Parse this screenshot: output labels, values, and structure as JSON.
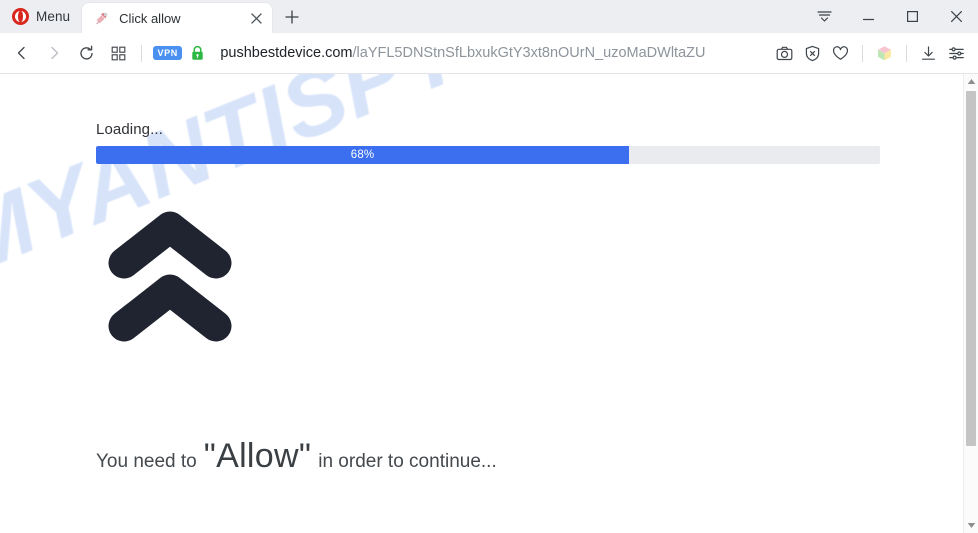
{
  "window": {
    "controls": [
      {
        "name": "tab-list-button",
        "icon": "tab-list-icon",
        "label": "≡"
      },
      {
        "name": "minimize-button",
        "icon": "minimize-icon",
        "label": "—"
      },
      {
        "name": "maximize-button",
        "icon": "maximize-icon",
        "label": "□"
      },
      {
        "name": "close-button",
        "icon": "close-icon",
        "label": "✕"
      }
    ]
  },
  "tabstrip": {
    "menu_label": "Menu",
    "menu_icon": "opera-logo-icon",
    "new_tab_label": "+",
    "tabs": [
      {
        "title": "Click allow",
        "favicon": "page-favicon",
        "close_label": "✕",
        "active": true
      }
    ]
  },
  "toolbar": {
    "back_icon": "chevron-left-icon",
    "forward_icon": "chevron-right-icon",
    "reload_icon": "reload-icon",
    "tiles_icon": "grid-tiles-icon",
    "vpn_badge": "VPN",
    "lock_icon": "padlock-secure-icon",
    "lock_color": "#2cb742",
    "vpn_color": "#4a90f0",
    "url": {
      "host": "pushbestdevice.com",
      "path": "/laYFL5DNStnSfLbxukGtY3xt8nOUrN_uzoMaDWltaZU",
      "full": "pushbestdevice.com/laYFL5DNStnSfLbxukGtY3xt8nOUrN_uzoMaDWltaZU"
    },
    "right_icons": [
      {
        "name": "snapshot-camera-icon",
        "title": "Snapshot"
      },
      {
        "name": "ad-blocker-shield-icon",
        "title": "Ad blocker"
      },
      {
        "name": "heart-favorites-icon",
        "title": "Favorites"
      },
      {
        "name": "extensions-cube-icon",
        "title": "Extensions"
      },
      {
        "name": "downloads-icon",
        "title": "Downloads"
      },
      {
        "name": "easy-setup-sliders-icon",
        "title": "Easy setup"
      }
    ]
  },
  "page": {
    "watermark": "MYANTISPYWARE.COM",
    "watermark_color": "#d7e3f9",
    "loading_label": "Loading...",
    "progress": {
      "percent_label": "68%",
      "percent_value": 68,
      "fill_color": "#3b6ff0",
      "track_color": "#e9ebee"
    },
    "arrow_icon": "double-chevron-up-icon",
    "arrow_color": "#1f2430",
    "prompt": {
      "prefix": "You need to",
      "emphasis": "\"Allow\"",
      "suffix": "in order to continue..."
    }
  },
  "scrollbar": {
    "up_arrow": "scroll-up-arrow-icon",
    "down_arrow": "scroll-down-arrow-icon"
  }
}
